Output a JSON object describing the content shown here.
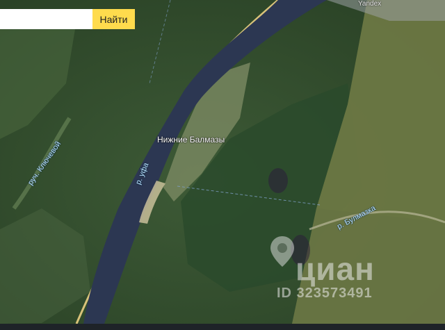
{
  "search": {
    "input_value": "",
    "placeholder": "",
    "button_label": "Найти"
  },
  "map": {
    "copyright": "Yandex",
    "labels": {
      "village": "Нижние Балмазы",
      "river_ufa": "р. уфа",
      "stream_klyuchevoy": "руч. Ключевой",
      "river_bulmazka": "р. Булмазка"
    },
    "watermark": {
      "brand": "циан",
      "listing_id": "ID 323573491"
    }
  }
}
